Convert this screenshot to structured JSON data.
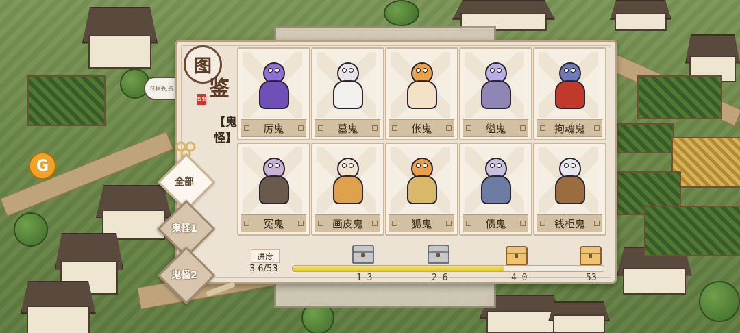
{
  "panel": {
    "title_chars": [
      "图",
      "鉴"
    ],
    "seal_text": "有鬼",
    "category_label": "【鬼怪】"
  },
  "tabs": [
    {
      "label": "全部",
      "active": true
    },
    {
      "label": "鬼怪1",
      "active": false
    },
    {
      "label": "鬼怪2",
      "active": false
    }
  ],
  "cards": [
    {
      "name": "厉鬼",
      "icon": "purple-ghost-icon",
      "head": "#8f6fd6",
      "body": "#6f4fb8"
    },
    {
      "name": "墓鬼",
      "icon": "hooded-ghost-icon",
      "head": "#e8e4ea",
      "body": "#f2f0ec"
    },
    {
      "name": "伥鬼",
      "icon": "tiger-ghost-icon",
      "head": "#e8a24a",
      "body": "#f3e2c6"
    },
    {
      "name": "缢鬼",
      "icon": "hanged-ghost-icon",
      "head": "#b9aee6",
      "body": "#8f86b5"
    },
    {
      "name": "拘魂鬼",
      "icon": "soul-catcher-ghost-icon",
      "head": "#6d7ab8",
      "body": "#c0392b"
    },
    {
      "name": "冤鬼",
      "icon": "wronged-ghost-icon",
      "head": "#c9b2d8",
      "body": "#6a5a4c"
    },
    {
      "name": "画皮鬼",
      "icon": "painted-skin-ghost-icon",
      "head": "#f1e3d2",
      "body": "#e0a14f"
    },
    {
      "name": "狐鬼",
      "icon": "fox-ghost-icon",
      "head": "#e9a04b",
      "body": "#d9b86a"
    },
    {
      "name": "债鬼",
      "icon": "debt-ghost-icon",
      "head": "#c7c0df",
      "body": "#6b7da3"
    },
    {
      "name": "钱柜鬼",
      "icon": "money-chest-ghost-icon",
      "head": "#eae6ef",
      "body": "#9a6c3e"
    }
  ],
  "progress": {
    "label": "进度",
    "count_text": "3 6/53",
    "current": 36,
    "total": 53,
    "milestones": [
      {
        "value": "1 3",
        "chest": "silver"
      },
      {
        "value": "2 6",
        "chest": "silver"
      },
      {
        "value": "4 0",
        "chest": "gold"
      },
      {
        "value": "53",
        "chest": "gold"
      }
    ]
  },
  "background": {
    "coin_symbol": "G",
    "speech_text": "ㄖ牧丢,费  买"
  }
}
